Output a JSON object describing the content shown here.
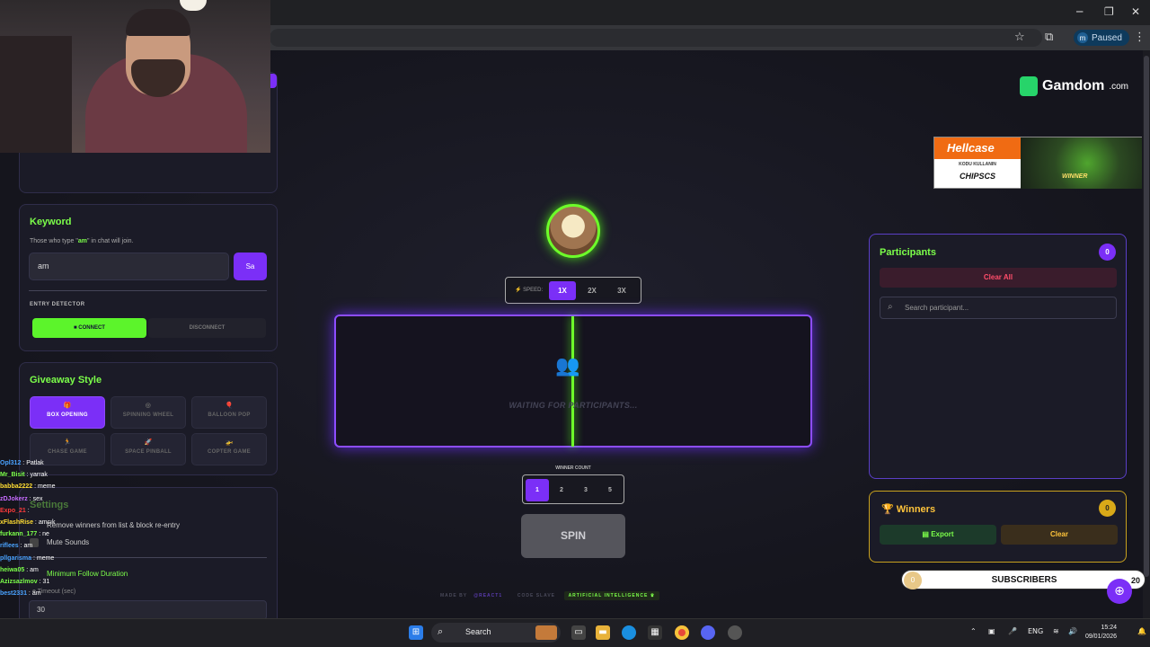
{
  "browser": {
    "profile_initial": "m",
    "profile_status": "Paused",
    "minimize_glyph": "─",
    "maximize_glyph": "❐",
    "close_glyph": "✕",
    "star_glyph": "☆",
    "ext_glyph": "⧉",
    "menu_glyph": "⋮"
  },
  "keyword": {
    "title": "Keyword",
    "description_pre": "Those who type \"",
    "description_kw": "am",
    "description_post": "\" in chat will join.",
    "value": "am",
    "save_label": "Sa",
    "entry_detector_label": "ENTRY DETECTOR",
    "connect_label": "■ CONNECT",
    "disconnect_label": "DISCONNECT"
  },
  "giveaway_style": {
    "title": "Giveaway Style",
    "options": [
      {
        "label": "BOX OPENING",
        "icon": "🎁",
        "active": true
      },
      {
        "label": "SPINNING WHEEL",
        "icon": "◎",
        "active": false
      },
      {
        "label": "BALLOON POP",
        "icon": "🎈",
        "active": false
      },
      {
        "label": "CHASE GAME",
        "icon": "🏃",
        "active": false
      },
      {
        "label": "SPACE PINBALL",
        "icon": "🚀",
        "active": false
      },
      {
        "label": "COPTER GAME",
        "icon": "🚁",
        "active": false
      }
    ]
  },
  "settings": {
    "title": "Settings",
    "option1": "Remove winners from list & block re-entry",
    "option2": "Mute Sounds",
    "option3": "Minimum Follow Duration",
    "timeout_label": "e Timeout (sec)",
    "timeout_value": "30"
  },
  "chat": [
    {
      "user": "Opl312",
      "msg": "Patlak",
      "color": "#4aa3ff"
    },
    {
      "user": "Mr_Bisit",
      "msg": "yarrak",
      "color": "#7cff4a"
    },
    {
      "user": "babba2222",
      "msg": "meme",
      "color": "#ffdd33"
    },
    {
      "user": "zDJokerz",
      "msg": "sex",
      "color": "#c76bff"
    },
    {
      "user": "Expo_21",
      "msg": "",
      "color": "#ff3b3b"
    },
    {
      "user": "xFlashRise",
      "msg": "amcık",
      "color": "#ffdd33"
    },
    {
      "user": "furkann_177",
      "msg": "ne",
      "color": "#7cff4a"
    },
    {
      "user": "riflees",
      "msg": "am",
      "color": "#4aa3ff"
    },
    {
      "user": "pllgarisma",
      "msg": "meme",
      "color": "#4aa3ff"
    },
    {
      "user": "heiwa05",
      "msg": "am",
      "color": "#7cff4a"
    },
    {
      "user": "Azizsazlmov",
      "msg": "31",
      "color": "#7cff4a"
    },
    {
      "user": "best2331",
      "msg": "am",
      "color": "#4aa3ff"
    }
  ],
  "speed": {
    "label": "SPEED:",
    "options": [
      "1X",
      "2X",
      "3X"
    ],
    "active_index": 0
  },
  "reel": {
    "waiting_text": "WAITING FOR PARTICIPANTS..."
  },
  "winner_count": {
    "label": "WINNER COUNT",
    "options": [
      "1",
      "2",
      "3",
      "5"
    ],
    "active_index": 0
  },
  "spin_label": "SPIN",
  "footer": {
    "made_by": "MADE BY",
    "author": "@REACT1",
    "code_slave": "CODE SLAVE",
    "ai": "ARTIFICIAL INTELLIGENCE ♛"
  },
  "sponsor": {
    "gamdom_name": "Gamdom",
    "gamdom_tld": ".com",
    "hellcase_name": "Hellcase",
    "hellcase_line1": "KODU KULLANIN",
    "hellcase_code": "CHIPSCS",
    "hellcase_winner": "WINNER"
  },
  "participants": {
    "title": "Participants",
    "count": "0",
    "clear_all_label": "Clear All",
    "search_placeholder": "Search participant..."
  },
  "winners": {
    "title": "Winners",
    "count": "0",
    "export_label": "Export",
    "clear_label": "Clear"
  },
  "subs": {
    "left": "0",
    "label": "SUBSCRIBERS",
    "right": "20"
  },
  "taskbar": {
    "search_label": "Search",
    "lang": "ENG",
    "time": "15:24",
    "date": "09/01/2026"
  },
  "colors": {
    "accent": "#7b2ff7",
    "green": "#7cff4a",
    "gold": "#d9a918"
  }
}
